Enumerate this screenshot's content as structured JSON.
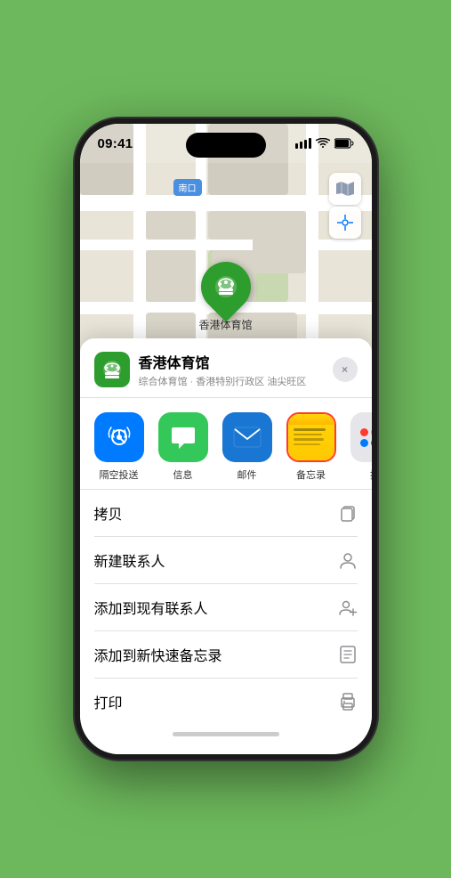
{
  "status_bar": {
    "time": "09:41",
    "signal_bars": "▌▌▌",
    "wifi": "wifi",
    "battery": "battery"
  },
  "map": {
    "label_blue": "南口",
    "pin_label": "香港体育馆"
  },
  "venue": {
    "name": "香港体育馆",
    "description": "综合体育馆 · 香港特别行政区 油尖旺区"
  },
  "close_button": "×",
  "share_items": [
    {
      "id": "airdrop",
      "label": "隔空投送",
      "type": "airdrop"
    },
    {
      "id": "messages",
      "label": "信息",
      "type": "messages"
    },
    {
      "id": "mail",
      "label": "邮件",
      "type": "mail"
    },
    {
      "id": "notes",
      "label": "备忘录",
      "type": "notes"
    },
    {
      "id": "more",
      "label": "提",
      "type": "more"
    }
  ],
  "actions": [
    {
      "id": "copy",
      "label": "拷贝",
      "icon": "copy"
    },
    {
      "id": "new-contact",
      "label": "新建联系人",
      "icon": "person"
    },
    {
      "id": "add-existing",
      "label": "添加到现有联系人",
      "icon": "person-add"
    },
    {
      "id": "add-notes",
      "label": "添加到新快速备忘录",
      "icon": "note"
    },
    {
      "id": "print",
      "label": "打印",
      "icon": "print"
    }
  ]
}
